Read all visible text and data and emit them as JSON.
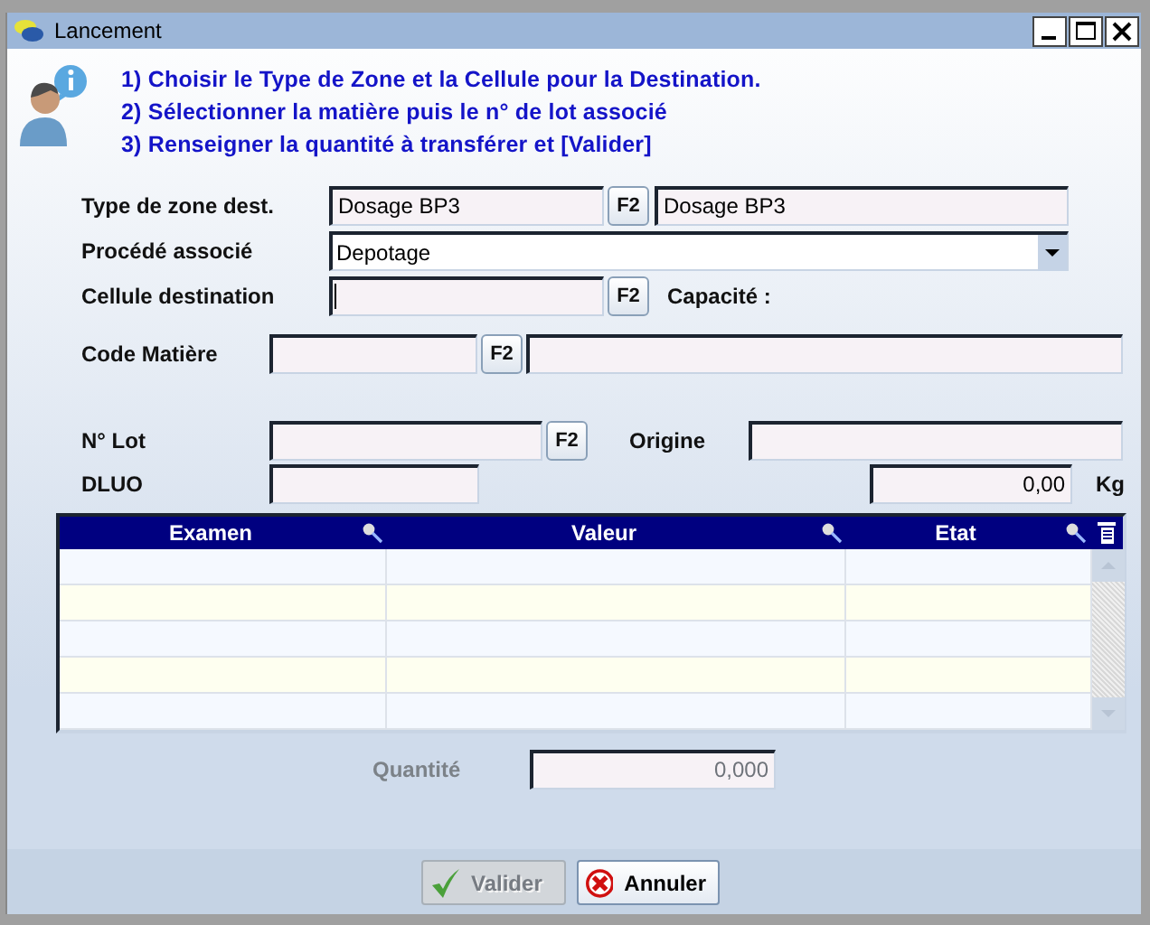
{
  "window": {
    "title": "Lancement"
  },
  "instructions": [
    "1) Choisir le Type de Zone et la Cellule pour la Destination.",
    "2) Sélectionner la matière puis le n° de lot associé",
    "3) Renseigner la quantité à transférer et [Valider]"
  ],
  "form": {
    "type_zone": {
      "label": "Type de zone dest.",
      "value": "Dosage BP3",
      "key": "F2",
      "description": "Dosage BP3"
    },
    "procede": {
      "label": "Procédé associé",
      "value": "Depotage"
    },
    "cellule": {
      "label": "Cellule destination",
      "key": "F2",
      "focused": true,
      "capacity_label": "Capacité :"
    },
    "code_matiere": {
      "label": "Code Matière",
      "key": "F2"
    },
    "lot": {
      "label": "N° Lot",
      "key": "F2",
      "origin_label": "Origine"
    },
    "dluo": {
      "label": "DLUO",
      "weight": "0,00",
      "unit": "Kg"
    }
  },
  "table": {
    "columns": [
      {
        "label": "Examen"
      },
      {
        "label": "Valeur"
      },
      {
        "label": "Etat"
      }
    ]
  },
  "quantity": {
    "label": "Quantité",
    "value": "0,000",
    "disabled": true
  },
  "buttons": [
    {
      "kind": "ok",
      "label": "Valider",
      "disabled": true
    },
    {
      "kind": "cancel",
      "label": "Annuler",
      "disabled": false
    }
  ]
}
